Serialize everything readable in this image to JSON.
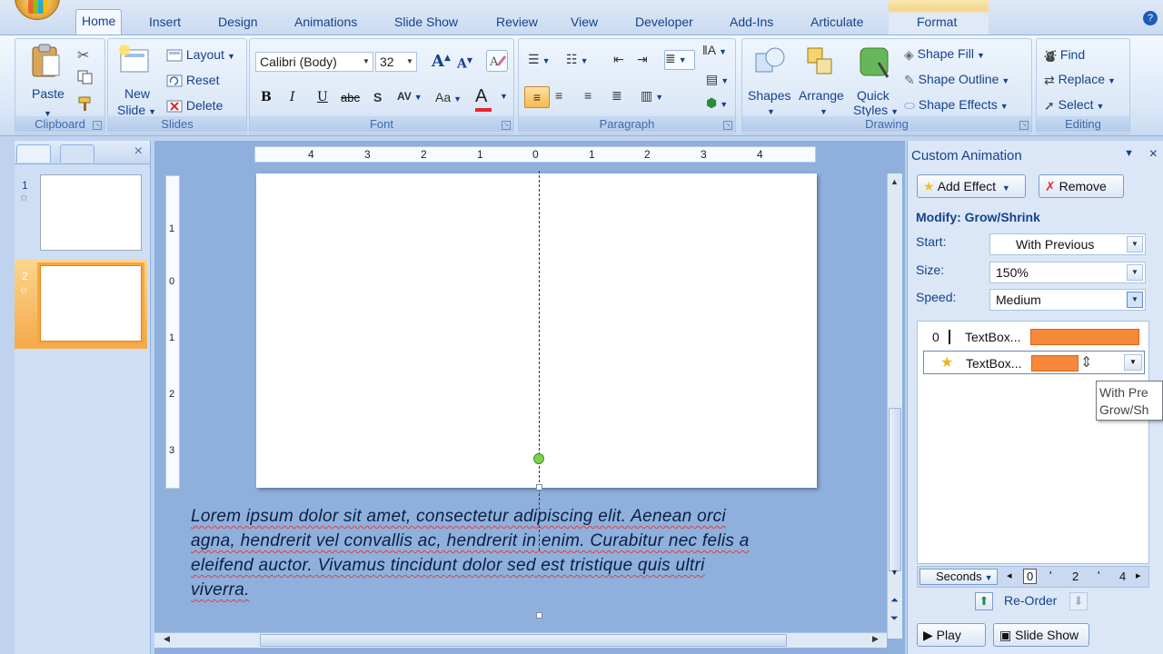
{
  "tabs": [
    {
      "label": "Home",
      "active": true
    },
    {
      "label": "Insert"
    },
    {
      "label": "Design"
    },
    {
      "label": "Animations"
    },
    {
      "label": "Slide Show"
    },
    {
      "label": "Review"
    },
    {
      "label": "View"
    },
    {
      "label": "Developer"
    },
    {
      "label": "Add-Ins"
    },
    {
      "label": "Articulate"
    },
    {
      "label": "Format"
    }
  ],
  "ribbon": {
    "clipboard": {
      "label": "Clipboard",
      "paste": "Paste"
    },
    "slides": {
      "label": "Slides",
      "new_slide": "New\nSlide",
      "new_slide_1": "New",
      "new_slide_2": "Slide",
      "layout": "Layout",
      "reset": "Reset",
      "delete": "Delete"
    },
    "font": {
      "label": "Font",
      "family": "Calibri (Body)",
      "size": "32"
    },
    "paragraph": {
      "label": "Paragraph"
    },
    "drawing": {
      "label": "Drawing",
      "shapes": "Shapes",
      "arrange": "Arrange",
      "quick_styles_1": "Quick",
      "quick_styles_2": "Styles",
      "shape_fill": "Shape Fill",
      "shape_outline": "Shape Outline",
      "shape_effects": "Shape Effects"
    },
    "editing": {
      "label": "Editing",
      "find": "Find",
      "replace": "Replace",
      "select": "Select"
    }
  },
  "left_pane": {
    "slides": [
      {
        "num": "1"
      },
      {
        "num": "2",
        "selected": true
      }
    ]
  },
  "ruler": {
    "h_ticks": [
      "4",
      "3",
      "2",
      "1",
      "0",
      "1",
      "2",
      "3",
      "4"
    ],
    "v_ticks": [
      "1",
      "0",
      "1",
      "2",
      "3"
    ]
  },
  "overflow_text": [
    "Lorem ipsum dolor sit amet, consectetur adipiscing elit. Aenean orci",
    "agna, hendrerit vel convallis ac, hendrerit in enim. Curabitur nec felis a",
    "eleifend auctor. Vivamus tincidunt dolor sed est tristique quis ultri",
    "viverra."
  ],
  "custom_animation": {
    "title": "Custom Animation",
    "add_effect": "Add Effect",
    "remove": "Remove",
    "modify": "Modify: Grow/Shrink",
    "start_label": "Start:",
    "start_value": "With Previous",
    "size_label": "Size:",
    "size_value": "150%",
    "speed_label": "Speed:",
    "speed_value": "Medium",
    "items": [
      {
        "order": "0",
        "name": "TextBox..."
      },
      {
        "order": "",
        "name": "TextBox..."
      }
    ],
    "tooltip_1": "With Pre",
    "tooltip_2": "Grow/Sh",
    "timeline_unit": "Seconds",
    "timeline_ticks": [
      "0",
      "2",
      "4"
    ],
    "reorder": "Re-Order",
    "play": "Play",
    "slide_show": "Slide Show"
  }
}
